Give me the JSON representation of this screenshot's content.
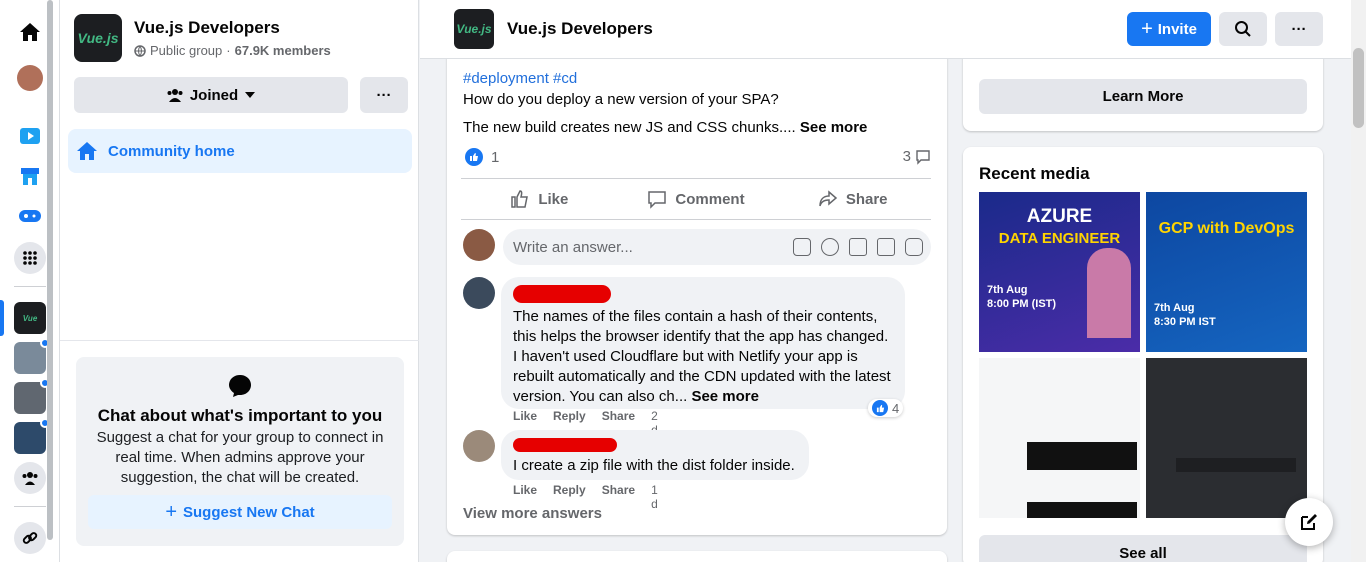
{
  "rail": {
    "items": [
      "home-icon",
      "profile-avatar",
      "watch-icon",
      "marketplace-icon",
      "gaming-icon",
      "menu-grid-icon",
      "vuejs-group-avatar",
      "group-avatar-2",
      "group-avatar-3",
      "group-avatar-4",
      "groups-icon",
      "link-icon"
    ]
  },
  "group": {
    "name": "Vue.js Developers",
    "logo_text": "Vue.js",
    "privacy": "Public group",
    "separator": " · ",
    "members": "67.9K members",
    "joined_label": "Joined",
    "more_label": "···",
    "community_home": "Community home"
  },
  "chat": {
    "title": "Chat about what's important to you",
    "description": "Suggest a chat for your group to connect in real time. When admins approve your suggestion, the chat will be created.",
    "button": "Suggest New Chat"
  },
  "header": {
    "title": "Vue.js Developers",
    "invite_label": "Invite",
    "more_label": "···"
  },
  "post": {
    "tags": "#deployment #cd",
    "title": "How do you deploy a new version of your SPA?",
    "body": "The new build creates new JS and CSS chunks.... ",
    "see_more": "See more",
    "like_count": "1",
    "comment_count": "3",
    "actions": {
      "like": "Like",
      "comment": "Comment",
      "share": "Share"
    },
    "write_placeholder": "Write an answer...",
    "view_more": "View more answers"
  },
  "comments": [
    {
      "text": "The names of the files contain a hash of their contents, this helps the browser identify that the app has changed. I haven't used Cloudflare but with Netlify your app is rebuilt automatically and the CDN updated with the latest version. You can also ch... ",
      "see_more": "See more",
      "reactions": "4",
      "like": "Like",
      "reply": "Reply",
      "share": "Share",
      "time": "2 d"
    },
    {
      "text": "I create a zip file with the dist folder inside.",
      "like": "Like",
      "reply": "Reply",
      "share": "Share",
      "time": "1 d"
    }
  ],
  "right": {
    "learn_more": "Learn More",
    "recent_media_title": "Recent media",
    "media": [
      {
        "line1": "AZURE",
        "line2": "DATA ENGINEER",
        "date": "7th Aug",
        "time": "8:00 PM (IST)"
      },
      {
        "line1": "GCP with DevOps",
        "line2": "",
        "date": "7th Aug",
        "time": "8:30 PM IST"
      },
      {
        "line1": "",
        "line2": ""
      },
      {
        "line1": "",
        "line2": ""
      }
    ],
    "see_all": "See all"
  },
  "colors": {
    "accent": "#1877f2",
    "background": "#f0f2f5",
    "redaction": "#e60000",
    "vue_green": "#42b883"
  }
}
